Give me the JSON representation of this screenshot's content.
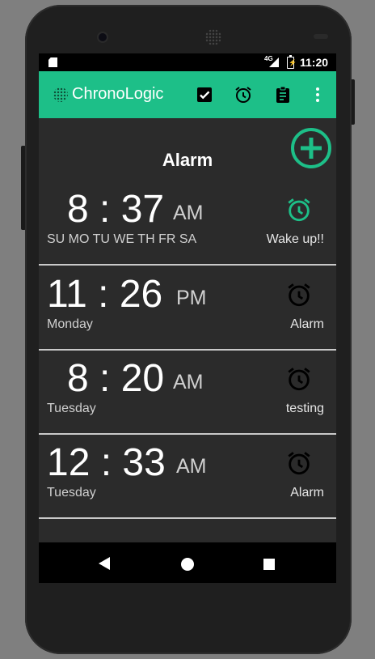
{
  "statusbar": {
    "network": "4G",
    "time": "11:20"
  },
  "appbar": {
    "title": "ChronoLogic",
    "icons": [
      "check-box-icon",
      "alarm-clock-icon",
      "clipboard-icon",
      "more-vert-icon"
    ]
  },
  "page": {
    "title": "Alarm"
  },
  "colors": {
    "accent": "#1dbf88",
    "active_alarm": "#1dbf88",
    "inactive_alarm": "#000000"
  },
  "alarms": [
    {
      "hour": "8",
      "minute": "37",
      "ampm": "AM",
      "days": "SU MO TU WE TH FR SA",
      "label": "Wake up!!",
      "active": true
    },
    {
      "hour": "11",
      "minute": "26",
      "ampm": "PM",
      "days": "Monday",
      "label": "Alarm",
      "active": false
    },
    {
      "hour": "8",
      "minute": "20",
      "ampm": "AM",
      "days": "Tuesday",
      "label": "testing",
      "active": false
    },
    {
      "hour": "12",
      "minute": "33",
      "ampm": "AM",
      "days": "Tuesday",
      "label": "Alarm",
      "active": false
    }
  ]
}
